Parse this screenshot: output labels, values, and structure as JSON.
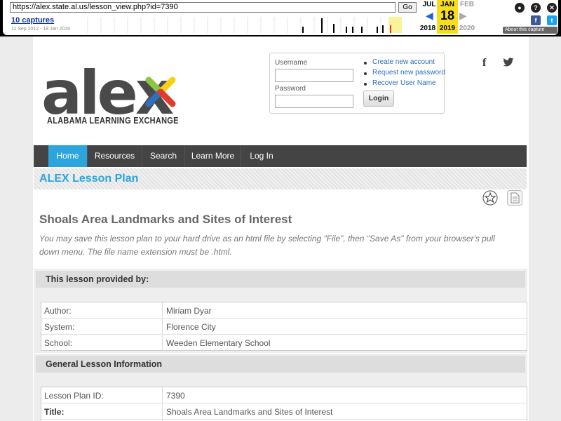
{
  "wayback": {
    "url": "https://alex.state.al.us/lesson_view.php?id=7390",
    "go_label": "Go",
    "captures_label": "10 captures",
    "date_range": "11 Sep 2012 - 18 Jan 2019",
    "months": [
      "JUL",
      "JAN",
      "FEB"
    ],
    "day": "18",
    "years": [
      "2018",
      "2019",
      "2020"
    ],
    "about_label": "About this capture"
  },
  "header": {
    "logo_word": "alex",
    "logo_subtitle": "ALABAMA LEARNING EXCHANGE",
    "login": {
      "username_label": "Username",
      "password_label": "Password",
      "login_button": "Login",
      "links": [
        "Create new account",
        "Request new password",
        "Recover User Name"
      ]
    }
  },
  "nav": {
    "items": [
      "Home",
      "Resources",
      "Search",
      "Learn More",
      "Log In"
    ],
    "active": "Home"
  },
  "lesson_plan_heading": "ALEX Lesson Plan",
  "lesson": {
    "title": "Shoals Area Landmarks and Sites of Interest",
    "save_note": "You may save this lesson plan to your hard drive as an html file by selecting \"File\", then \"Save As\" from your browser's pull down menu. The file name extension must be .html."
  },
  "provided_by": {
    "heading": "This lesson provided by:",
    "rows": [
      {
        "key": "Author:",
        "value": "Miriam Dyar"
      },
      {
        "key": "System:",
        "value": "Florence City"
      },
      {
        "key": "School:",
        "value": "Weeden Elementary School"
      }
    ]
  },
  "general_info": {
    "heading": "General Lesson Information",
    "rows": [
      {
        "key": "Lesson Plan ID:",
        "value": "7390"
      },
      {
        "key": "Title:",
        "value": "Shoals Area Landmarks and Sites of Interest"
      }
    ]
  },
  "colors": {
    "accent": "#2ca5dd",
    "nav_bg": "#444444",
    "logo_green": "#8cc63f",
    "logo_yellow": "#f7d117",
    "logo_blue": "#2e6fc1",
    "logo_red": "#e23b2c"
  }
}
